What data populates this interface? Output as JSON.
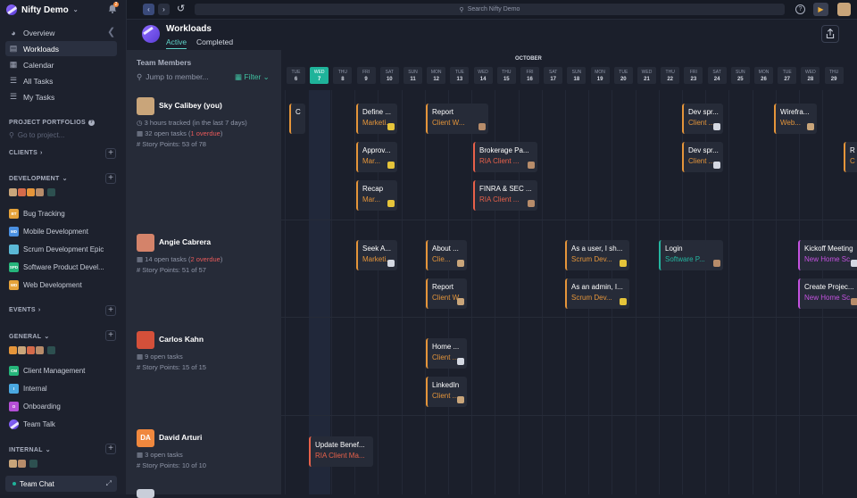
{
  "app": {
    "workspace_name": "Nifty Demo",
    "notification_count": "2",
    "search_placeholder": "Search Nifty Demo"
  },
  "sidebar": {
    "nav": [
      {
        "label": "Overview",
        "icon": "overview-icon"
      },
      {
        "label": "Workloads",
        "icon": "chart-icon"
      },
      {
        "label": "Calendar",
        "icon": "calendar-icon"
      },
      {
        "label": "All Tasks",
        "icon": "list-icon"
      },
      {
        "label": "My Tasks",
        "icon": "list-icon"
      }
    ],
    "portfolios_label": "PROJECT PORTFOLIOS",
    "goto_placeholder": "Go to project...",
    "sections": [
      {
        "label": "CLIENTS"
      },
      {
        "label": "DEVELOPMENT",
        "projects": [
          {
            "abbr": "BT",
            "label": "Bug Tracking",
            "color": "#e5a23a"
          },
          {
            "abbr": "MD",
            "label": "Mobile Development",
            "color": "#4a90e2"
          },
          {
            "abbr": "SD",
            "label": "Scrum Development Epic",
            "color": "#5bb8d6"
          },
          {
            "abbr": "SPD",
            "label": "Software Product Devel...",
            "color": "#25b57a"
          },
          {
            "abbr": "WD",
            "label": "Web Development",
            "color": "#e5a23a"
          }
        ]
      },
      {
        "label": "EVENTS"
      },
      {
        "label": "GENERAL",
        "projects": [
          {
            "abbr": "CM",
            "label": "Client Management",
            "color": "#25b57a"
          },
          {
            "abbr": "I",
            "label": "Internal",
            "color": "#4aa8e0"
          },
          {
            "abbr": "O",
            "label": "Onboarding",
            "color": "#b44fd6"
          },
          {
            "abbr": "",
            "label": "Team Talk",
            "color": "#7d5ce0"
          }
        ]
      },
      {
        "label": "INTERNAL"
      }
    ],
    "team_chat_label": "Team Chat"
  },
  "header": {
    "title": "Workloads",
    "tabs": [
      "Active",
      "Completed"
    ],
    "active_tab": "Active"
  },
  "members_panel": {
    "heading": "Team Members",
    "jump_placeholder": "Jump to member...",
    "filter_label": "Filter",
    "members": [
      {
        "name": "Sky Calibey (you)",
        "tracked": "3 hours tracked (in the last 7 days)",
        "open_tasks": "32 open tasks",
        "overdue": "1 overdue",
        "story_points": "Story Points: 53 of 78"
      },
      {
        "name": "Angie Cabrera",
        "open_tasks": "14 open tasks",
        "overdue": "2 overdue",
        "story_points": "Story Points: 51 of 57"
      },
      {
        "name": "Carlos Kahn",
        "open_tasks": "9 open tasks",
        "story_points": "Story Points: 15 of 15"
      },
      {
        "name": "David Arturi",
        "initials": "DA",
        "open_tasks": "3 open tasks",
        "story_points": "Story Points: 10 of 10"
      }
    ]
  },
  "timeline": {
    "month": "OCTOBER",
    "days": [
      {
        "dow": "TUE",
        "num": "6"
      },
      {
        "dow": "WED",
        "num": "7",
        "today": true
      },
      {
        "dow": "THU",
        "num": "8"
      },
      {
        "dow": "FRI",
        "num": "9"
      },
      {
        "dow": "SAT",
        "num": "10"
      },
      {
        "dow": "SUN",
        "num": "11"
      },
      {
        "dow": "MON",
        "num": "12"
      },
      {
        "dow": "TUE",
        "num": "13"
      },
      {
        "dow": "WED",
        "num": "14"
      },
      {
        "dow": "THU",
        "num": "15"
      },
      {
        "dow": "FRI",
        "num": "16"
      },
      {
        "dow": "SAT",
        "num": "17"
      },
      {
        "dow": "SUN",
        "num": "18"
      },
      {
        "dow": "MON",
        "num": "19"
      },
      {
        "dow": "TUE",
        "num": "20"
      },
      {
        "dow": "WED",
        "num": "21"
      },
      {
        "dow": "THU",
        "num": "22"
      },
      {
        "dow": "FRI",
        "num": "23"
      },
      {
        "dow": "SAT",
        "num": "24"
      },
      {
        "dow": "SUN",
        "num": "25"
      },
      {
        "dow": "MON",
        "num": "26"
      },
      {
        "dow": "TUE",
        "num": "27"
      },
      {
        "dow": "WED",
        "num": "28"
      },
      {
        "dow": "THU",
        "num": "29"
      }
    ],
    "tasks": [
      {
        "title": "C",
        "sub": "",
        "color": "#e5953a"
      },
      {
        "title": "Define ...",
        "sub": "Marketi...",
        "color": "#e5953a"
      },
      {
        "title": "Report",
        "sub": "Client W...",
        "color": "#e5953a"
      },
      {
        "title": "Dev spr...",
        "sub": "Client ...",
        "color": "#e5953a"
      },
      {
        "title": "Wirefra...",
        "sub": "Web...",
        "color": "#e5953a"
      },
      {
        "title": "Approv...",
        "sub": "Mar...",
        "color": "#e5953a"
      },
      {
        "title": "Brokerage Pa...",
        "sub": "RIA Client ...",
        "color": "#e8614a"
      },
      {
        "title": "Dev spr...",
        "sub": "Client ...",
        "color": "#e5953a"
      },
      {
        "title": "R",
        "sub": "C",
        "color": "#e5953a"
      },
      {
        "title": "Recap",
        "sub": "Mar...",
        "color": "#e5953a"
      },
      {
        "title": "FINRA & SEC ...",
        "sub": "RIA Client ...",
        "color": "#e8614a"
      },
      {
        "title": "Seek A...",
        "sub": "Marketi...",
        "color": "#e5953a"
      },
      {
        "title": "About ...",
        "sub": "Clie...",
        "color": "#e5953a"
      },
      {
        "title": "As a user, I sh...",
        "sub": "Scrum Dev...",
        "color": "#e5953a"
      },
      {
        "title": "Login",
        "sub": "Software P...",
        "color": "#25b5a0"
      },
      {
        "title": "Kickoff Meeting",
        "sub": "New Home Sc...",
        "color": "#c452e0"
      },
      {
        "title": "Report",
        "sub": "Client W...",
        "color": "#e5953a"
      },
      {
        "title": "As an admin, I...",
        "sub": "Scrum Dev...",
        "color": "#e5953a"
      },
      {
        "title": "Create Projec...",
        "sub": "New Home Sc...",
        "color": "#c452e0"
      },
      {
        "title": "Home ...",
        "sub": "Client ...",
        "color": "#e5953a"
      },
      {
        "title": "LinkedIn",
        "sub": "Client ...",
        "color": "#e5953a"
      },
      {
        "title": "Update Benef...",
        "sub": "RIA Client Ma...",
        "color": "#e8614a"
      }
    ]
  }
}
